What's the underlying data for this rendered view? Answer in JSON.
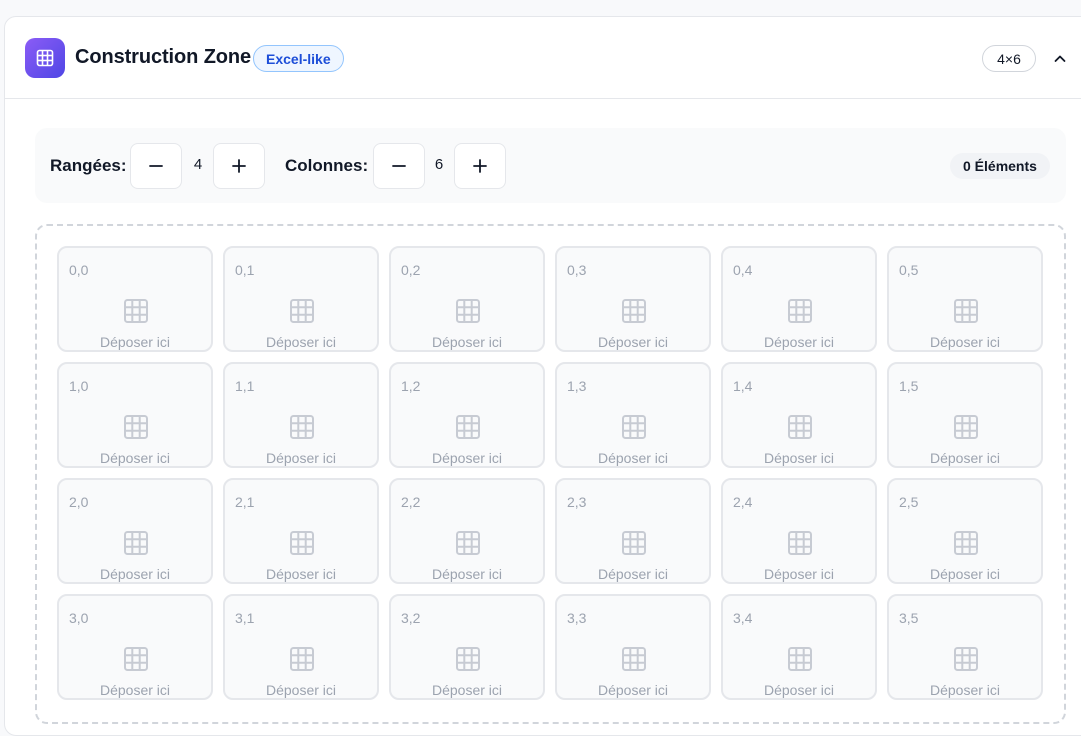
{
  "header": {
    "title": "Construction Zone",
    "badge": "Excel-like",
    "size_label": "4×6",
    "app_icon": "grid-icon",
    "collapse_icon": "chevron-up-icon"
  },
  "toolbar": {
    "rows_label": "Rangées:",
    "rows_value": "4",
    "cols_label": "Colonnes:",
    "cols_value": "6",
    "minus_icon": "minus-icon",
    "plus_icon": "plus-icon",
    "elements_count": "0 Éléments"
  },
  "grid": {
    "drop_label": "Déposer ici",
    "cell_icon": "grid-icon",
    "rows": [
      [
        "0,0",
        "0,1",
        "0,2",
        "0,3",
        "0,4",
        "0,5"
      ],
      [
        "1,0",
        "1,1",
        "1,2",
        "1,3",
        "1,4",
        "1,5"
      ],
      [
        "2,0",
        "2,1",
        "2,2",
        "2,3",
        "2,4",
        "2,5"
      ],
      [
        "3,0",
        "3,1",
        "3,2",
        "3,3",
        "3,4",
        "3,5"
      ]
    ]
  },
  "colors": {
    "accent_gradient_start": "#8b5cf6",
    "accent_gradient_end": "#4f46e5",
    "badge_text": "#1d4ed8",
    "badge_border": "#93c5fd",
    "muted": "#9ca3af"
  }
}
